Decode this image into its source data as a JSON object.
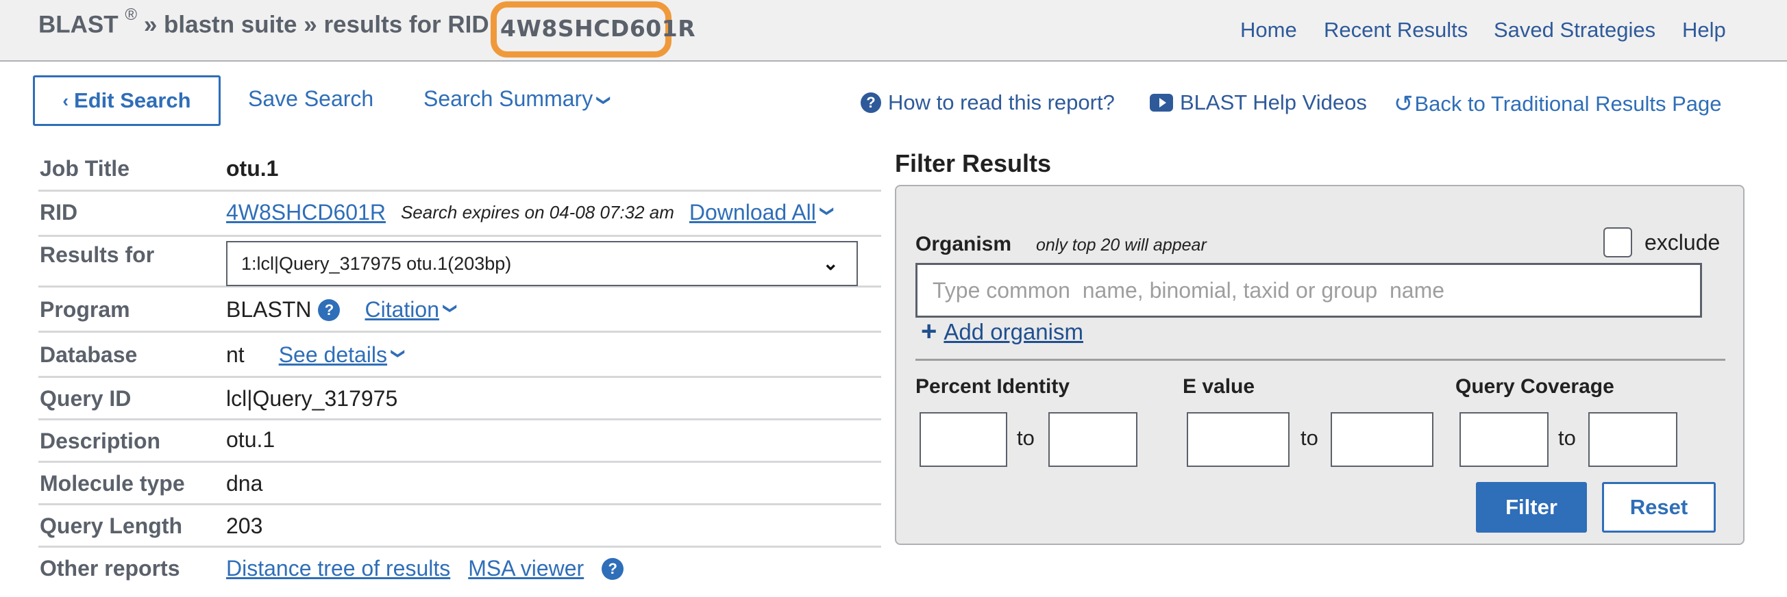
{
  "header": {
    "brand": "BLAST",
    "registered_mark": "®",
    "separator": "»",
    "suite": "blastn suite",
    "results_prefix": "results for RID",
    "rid": "4W8SHCD601R",
    "highlight_color": "#f0993b",
    "nav": [
      {
        "label": "Home"
      },
      {
        "label": "Recent Results"
      },
      {
        "label": "Saved Strategies"
      },
      {
        "label": "Help"
      }
    ]
  },
  "toolbar": {
    "edit_search": "Edit Search",
    "save_search": "Save Search",
    "search_summary": "Search Summary",
    "how_to_read": "How to read this report?",
    "help_videos": "BLAST Help Videos",
    "back_traditional": "Back to Traditional Results Page"
  },
  "summary": {
    "job_title": {
      "label": "Job Title",
      "value": "otu.1"
    },
    "rid": {
      "label": "RID",
      "value": "4W8SHCD601R",
      "expires": "Search expires on 04-08 07:32 am",
      "download_all": "Download All"
    },
    "results_for": {
      "label": "Results for",
      "selected": "1:lcl|Query_317975 otu.1(203bp)"
    },
    "program": {
      "label": "Program",
      "value": "BLASTN",
      "citation": "Citation"
    },
    "database": {
      "label": "Database",
      "value": "nt",
      "see_details": "See details"
    },
    "query_id": {
      "label": "Query ID",
      "value": "lcl|Query_317975"
    },
    "description": {
      "label": "Description",
      "value": "otu.1"
    },
    "molecule_type": {
      "label": "Molecule type",
      "value": "dna"
    },
    "query_length": {
      "label": "Query Length",
      "value": "203"
    },
    "other_reports": {
      "label": "Other reports",
      "links": [
        "Distance tree of results",
        "MSA viewer"
      ]
    }
  },
  "filter": {
    "title": "Filter Results",
    "organism_label": "Organism",
    "organism_hint": "only top 20 will appear",
    "exclude_label": "exclude",
    "exclude_checked": false,
    "organism_placeholder": "Type common  name, binomial, taxid or group  name",
    "organism_value": "",
    "add_organism": "Add organism",
    "percent_identity": {
      "label": "Percent Identity",
      "from": "",
      "to": ""
    },
    "e_value": {
      "label": "E value",
      "from": "",
      "to": ""
    },
    "query_coverage": {
      "label": "Query Coverage",
      "from": "",
      "to": ""
    },
    "to_word": "to",
    "filter_button": "Filter",
    "reset_button": "Reset"
  },
  "icons": {
    "question": "?",
    "chevron_left": "‹",
    "chevron_down": "⌄",
    "undo": "↺",
    "plus": "+"
  }
}
